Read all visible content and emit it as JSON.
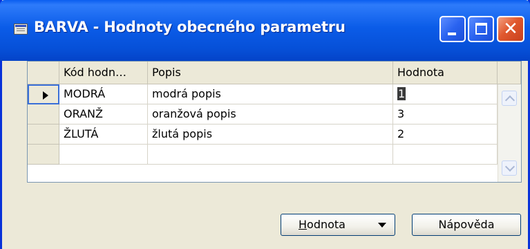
{
  "window": {
    "title": "BARVA - Hodnoty obecného parametru",
    "icon": "table-icon",
    "controls": [
      "minimize-icon",
      "maximize-icon",
      "close-icon"
    ]
  },
  "grid": {
    "columns": [
      "Kód hodn…",
      "Popis",
      "Hodnota"
    ],
    "rows": [
      {
        "code": "MODRÁ",
        "desc": "modrá popis",
        "value": "1",
        "active": true
      },
      {
        "code": "ORANŽ",
        "desc": "oranžová popis",
        "value": "3",
        "active": false
      },
      {
        "code": "ŽLUTÁ",
        "desc": "žlutá popis",
        "value": "2",
        "active": false
      },
      {
        "code": "",
        "desc": "",
        "value": "",
        "active": false
      }
    ]
  },
  "buttons": {
    "hodnota_first": "H",
    "hodnota_rest": "odnota",
    "napoveda": "Nápověda"
  },
  "colors": {
    "titlebar": "#0650d8",
    "window_bg": "#ece9d8",
    "close_button": "#e0582e"
  }
}
